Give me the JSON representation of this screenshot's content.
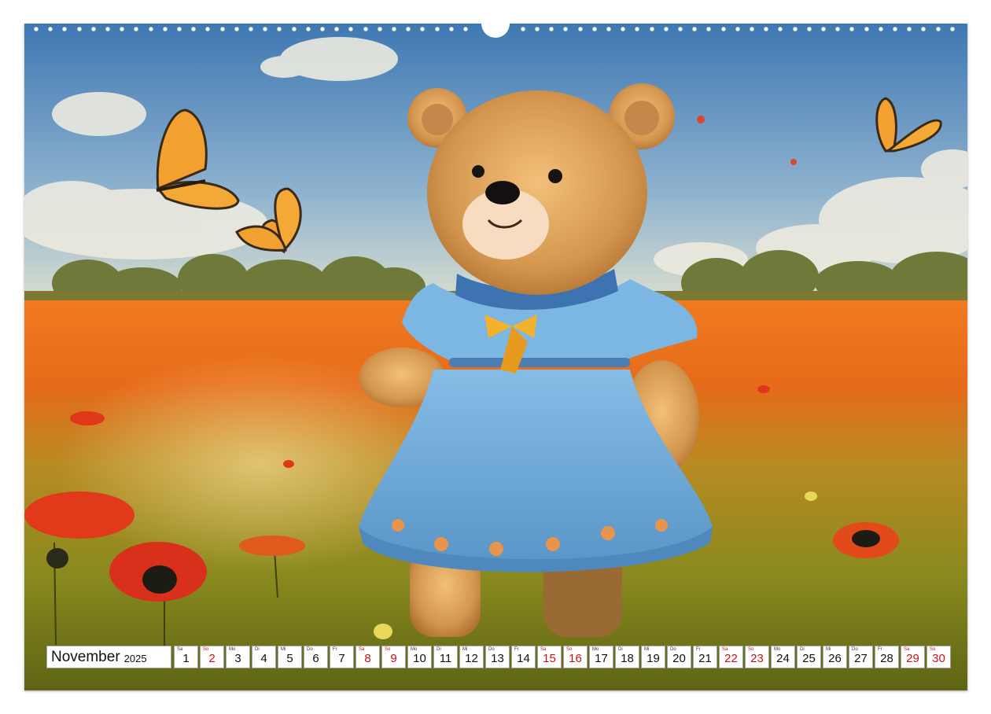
{
  "calendar": {
    "month": "November",
    "year": "2025",
    "days": [
      {
        "wd": "Sa",
        "n": "1",
        "red": false
      },
      {
        "wd": "So",
        "n": "2",
        "red": true
      },
      {
        "wd": "Mo",
        "n": "3",
        "red": false
      },
      {
        "wd": "Di",
        "n": "4",
        "red": false
      },
      {
        "wd": "Mi",
        "n": "5",
        "red": false
      },
      {
        "wd": "Do",
        "n": "6",
        "red": false
      },
      {
        "wd": "Fr",
        "n": "7",
        "red": false
      },
      {
        "wd": "Sa",
        "n": "8",
        "red": true
      },
      {
        "wd": "So",
        "n": "9",
        "red": true
      },
      {
        "wd": "Mo",
        "n": "10",
        "red": false
      },
      {
        "wd": "Di",
        "n": "11",
        "red": false
      },
      {
        "wd": "Mi",
        "n": "12",
        "red": false
      },
      {
        "wd": "Do",
        "n": "13",
        "red": false
      },
      {
        "wd": "Fr",
        "n": "14",
        "red": false
      },
      {
        "wd": "Sa",
        "n": "15",
        "red": true
      },
      {
        "wd": "So",
        "n": "16",
        "red": true
      },
      {
        "wd": "Mo",
        "n": "17",
        "red": false
      },
      {
        "wd": "Di",
        "n": "18",
        "red": false
      },
      {
        "wd": "Mi",
        "n": "19",
        "red": false
      },
      {
        "wd": "Do",
        "n": "20",
        "red": false
      },
      {
        "wd": "Fr",
        "n": "21",
        "red": false
      },
      {
        "wd": "Sa",
        "n": "22",
        "red": true
      },
      {
        "wd": "So",
        "n": "23",
        "red": true
      },
      {
        "wd": "Mo",
        "n": "24",
        "red": false
      },
      {
        "wd": "Di",
        "n": "25",
        "red": false
      },
      {
        "wd": "Mi",
        "n": "26",
        "red": false
      },
      {
        "wd": "Do",
        "n": "27",
        "red": false
      },
      {
        "wd": "Fr",
        "n": "28",
        "red": false
      },
      {
        "wd": "Sa",
        "n": "29",
        "red": true
      },
      {
        "wd": "So",
        "n": "30",
        "red": true
      }
    ]
  },
  "colors": {
    "sky_top": "#3f78b3",
    "field_orange": "#e8641a",
    "field_green": "#8a8a1e",
    "bear_fur": "#d4964e",
    "dress_blue": "#6aa6d6",
    "poppy_red": "#e0361a",
    "weekend_red": "#c4121a"
  }
}
